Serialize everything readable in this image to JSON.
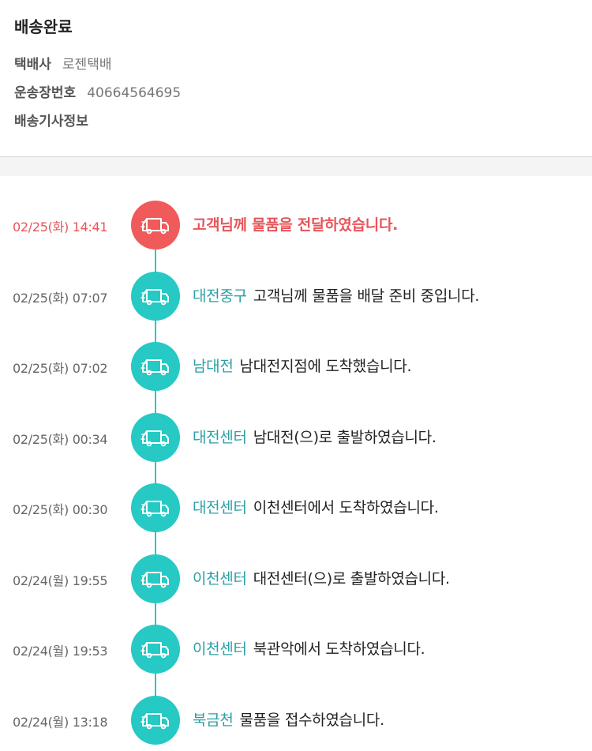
{
  "delivery": {
    "status": "배송완료",
    "courier_label": "택배사",
    "courier_value": "로젠택배",
    "tracking_label": "운송장번호",
    "tracking_value": "40664564695",
    "driver_label": "배송기사정보"
  },
  "timeline": [
    {
      "time": "02/25(화) 14:41",
      "location": "",
      "message": "고객님께 물품을 전달하였습니다.",
      "icon": "truck-icon",
      "current": true
    },
    {
      "time": "02/25(화) 07:07",
      "location": "대전중구",
      "message": "고객님께 물품을 배달 준비 중입니다.",
      "icon": "truck-icon",
      "current": false
    },
    {
      "time": "02/25(화) 07:02",
      "location": "남대전",
      "message": "남대전지점에 도착했습니다.",
      "icon": "truck-icon",
      "current": false
    },
    {
      "time": "02/25(화) 00:34",
      "location": "대전센터",
      "message": "남대전(으)로 출발하였습니다.",
      "icon": "truck-icon",
      "current": false
    },
    {
      "time": "02/25(화) 00:30",
      "location": "대전센터",
      "message": "이천센터에서 도착하였습니다.",
      "icon": "truck-icon",
      "current": false
    },
    {
      "time": "02/24(월) 19:55",
      "location": "이천센터",
      "message": "대전센터(으)로 출발하였습니다.",
      "icon": "truck-icon",
      "current": false
    },
    {
      "time": "02/24(월) 19:53",
      "location": "이천센터",
      "message": "북관악에서 도착하였습니다.",
      "icon": "truck-icon",
      "current": false
    },
    {
      "time": "02/24(월) 13:18",
      "location": "북금천",
      "message": "물품을 접수하였습니다.",
      "icon": "truck-icon",
      "current": false
    }
  ],
  "colors": {
    "current": "#f05a5a",
    "step": "#26c9c4",
    "location_text": "#2a9fa6"
  }
}
